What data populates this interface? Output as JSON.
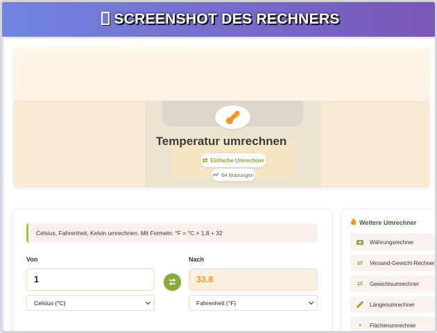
{
  "banner": {
    "title": "SCREENSHOT DES RECHNERS",
    "icon": "missing-glyph-icon"
  },
  "hero": {
    "title": "Temperatur umrechnen",
    "type_badge": "Einfache Umrechner",
    "uses_badge": "64 Nutzungen",
    "icon": "thermometer-icon"
  },
  "converter": {
    "description": "Celsius, Fahrenheit, Kelvin umrechnen. Mit Formeln: °F = °C × 1,8 + 32",
    "from_label": "Von",
    "to_label": "Nach",
    "from_value": "1",
    "to_value": "33.8",
    "from_unit": "Celsius (°C)",
    "to_unit": "Fahrenheit (°F)"
  },
  "sidebar": {
    "title": "Weitere Umrechner",
    "items": [
      {
        "label": "Währungsrechner",
        "icon": "money-icon"
      },
      {
        "label": "Versand-Gewicht-Rechner",
        "icon": "swap-icon"
      },
      {
        "label": "Gewichtsumrechner",
        "icon": "swap-icon"
      },
      {
        "label": "Längenumrechner",
        "icon": "ruler-icon"
      },
      {
        "label": "Flächenumrechner",
        "icon": "area-icon"
      }
    ]
  },
  "colors": {
    "accent": "#8aaa3a",
    "result": "#f19a27",
    "banner_start": "#7284e1",
    "banner_end": "#7a56b8"
  }
}
